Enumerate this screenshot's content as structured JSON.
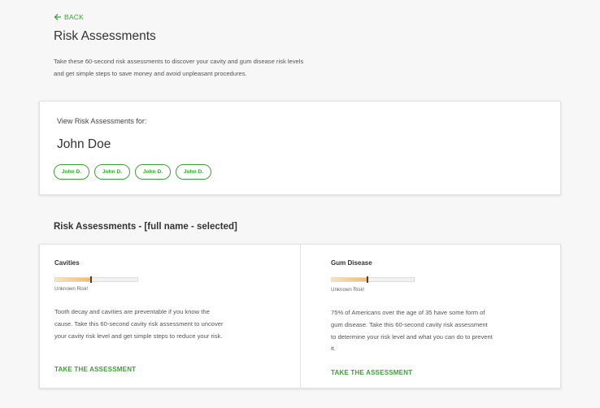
{
  "nav": {
    "back_label": "BACK"
  },
  "page": {
    "title": "Risk Assessments",
    "intro": "Take these 60-second risk assessments to discover your cavity and gum disease risk levels and get simple steps to save money and avoid unpleasant procedures."
  },
  "view_card": {
    "label": "View Risk Assessments for:",
    "selected_name": "John Doe",
    "chips": [
      {
        "label": "John D."
      },
      {
        "label": "John D."
      },
      {
        "label": "John D."
      },
      {
        "label": "John D."
      }
    ]
  },
  "results": {
    "title": "Risk Assessments - [full name - selected]",
    "cards": [
      {
        "title": "Cavities",
        "meter_level": 0.43,
        "status": "Unknown Risk!",
        "description": "Tooth decay and cavities are preventable if you know the cause. Take this 60-second cavity risk assessment to uncover your cavity risk level and get simple steps to reduce your risk.",
        "cta": "TAKE THE ASSESSMENT"
      },
      {
        "title": "Gum Disease",
        "meter_level": 0.43,
        "status": "Unknown Risk!",
        "description": "75% of Americans over the age of 35 have some form of gum disease. Take this 60-second cavity risk assessment to determine your risk level and what you can do to prevent it.",
        "cta": "TAKE THE ASSESSMENT"
      }
    ]
  },
  "colors": {
    "accent": "#3aa335",
    "meter": "#f6b96a",
    "background": "#f7f7f7"
  }
}
